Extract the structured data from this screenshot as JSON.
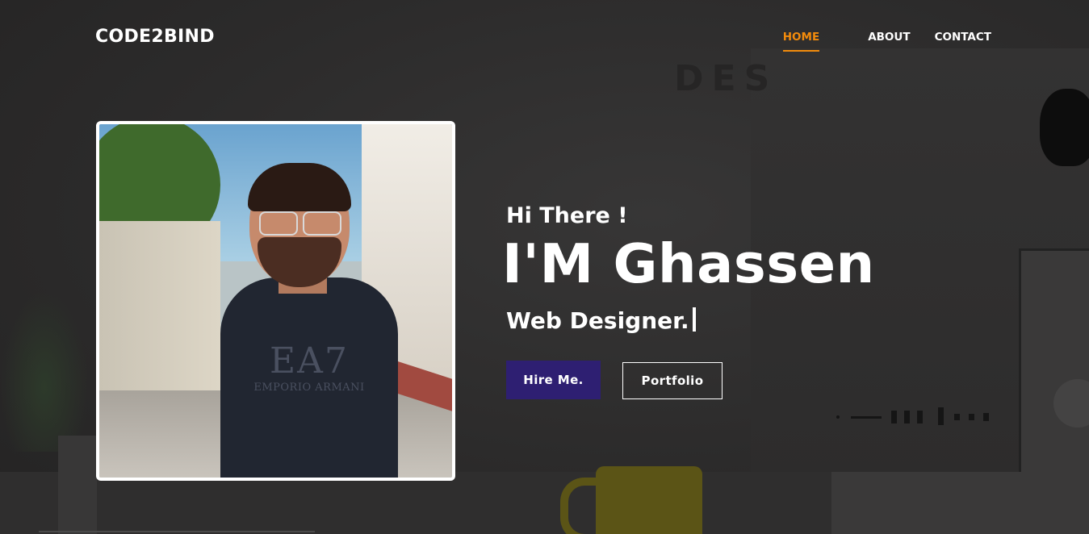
{
  "header": {
    "brand": "CODE2BIND",
    "nav": [
      {
        "label": "HOME",
        "active": true
      },
      {
        "label": "ABOUT",
        "active": false
      },
      {
        "label": "CONTACT",
        "active": false
      }
    ]
  },
  "hero": {
    "greeting": "Hi There !",
    "name": "I'M Ghassen",
    "role": "Web Designer.",
    "photo_shirt_logo": "EA7",
    "photo_shirt_brand": "EMPORIO ARMANI",
    "buttons": {
      "hire": "Hire Me.",
      "portfolio": "Portfolio"
    }
  },
  "colors": {
    "accent": "#f28b0c",
    "primary_button": "#2e1f72",
    "background": "#2b2a2a"
  }
}
